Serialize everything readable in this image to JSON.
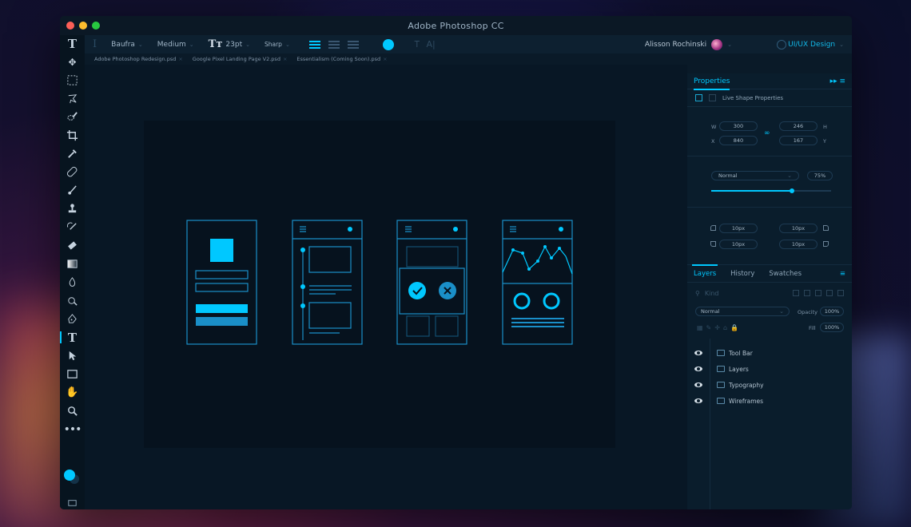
{
  "window": {
    "title": "Adobe Photoshop CC"
  },
  "options": {
    "font_family": "Baufra",
    "font_weight": "Medium",
    "size_glyph": "Tт",
    "font_size": "23pt",
    "antialias": "Sharp",
    "text_color": "#00c8ff"
  },
  "user": {
    "name": "Alisson Rochinski"
  },
  "workspace": {
    "label": "UI/UX Design"
  },
  "doc_tabs": [
    "Adobe Photoshop Redesign.psd",
    "Google Pixel Landing Page V2.psd",
    "Essentialism (Coming Soon).psd"
  ],
  "properties": {
    "title": "Properties",
    "subtitle": "Live Shape Properties",
    "w_label": "W",
    "w": "300",
    "h_label": "H",
    "h": "246",
    "x_label": "X",
    "x": "840",
    "y_label": "Y",
    "y": "167",
    "blend_mode": "Normal",
    "opacity": "75%",
    "opacity_fraction": 0.67,
    "corners": [
      "10px",
      "10px",
      "10px",
      "10px"
    ]
  },
  "layers_panel": {
    "tabs": [
      "Layers",
      "History",
      "Swatches"
    ],
    "kind_placeholder": "Kind",
    "blend_mode": "Normal",
    "opacity_label": "Opacity",
    "opacity": "100%",
    "fill_label": "Fill",
    "fill": "100%",
    "layers": [
      "Tool Bar",
      "Layers",
      "Typography",
      "Wireframes"
    ]
  },
  "colors": {
    "accent": "#00c8ff",
    "wire_stroke": "#1a8fc8"
  }
}
